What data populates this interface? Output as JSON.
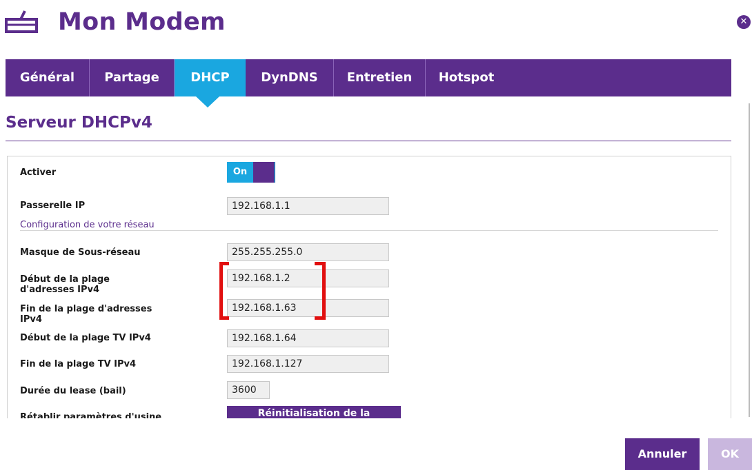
{
  "header": {
    "title": "Mon Modem",
    "icon": "modem-icon",
    "close_icon": "close-icon",
    "close_glyph": "✕"
  },
  "tabs": [
    {
      "label": "Général",
      "active": false
    },
    {
      "label": "Partage",
      "active": false
    },
    {
      "label": "DHCP",
      "active": true
    },
    {
      "label": "DynDNS",
      "active": false
    },
    {
      "label": "Entretien",
      "active": false
    },
    {
      "label": "Hotspot",
      "active": false
    }
  ],
  "section": {
    "title": "Serveur DHCPv4"
  },
  "form": {
    "activer": {
      "label": "Activer",
      "toggle_text": "On",
      "enabled": true
    },
    "passerelle": {
      "label": "Passerelle IP",
      "value": "192.168.1.1"
    },
    "config_heading": "Configuration de votre réseau",
    "masque": {
      "label": "Masque de Sous-réseau",
      "value": "255.255.255.0"
    },
    "debut_plage": {
      "label": "Début de la plage d'adresses IPv4",
      "value": "192.168.1.2"
    },
    "fin_plage": {
      "label": "Fin de la plage d'adresses IPv4",
      "value": "192.168.1.63"
    },
    "debut_tv": {
      "label": "Début de la plage TV IPv4",
      "value": "192.168.1.64"
    },
    "fin_tv": {
      "label": "Fin de la plage TV IPv4",
      "value": "192.168.1.127"
    },
    "lease": {
      "label": "Durée du lease (bail)",
      "value": "3600"
    },
    "reset": {
      "label": "Rétablir paramètres d'usine",
      "button_label": "Réinitialisation de la configuration"
    }
  },
  "footer": {
    "cancel_label": "Annuler",
    "ok_label": "OK"
  },
  "colors": {
    "brand_purple": "#5b2d8c",
    "active_tab": "#1aa7e0",
    "highlight": "#e10f0f"
  }
}
